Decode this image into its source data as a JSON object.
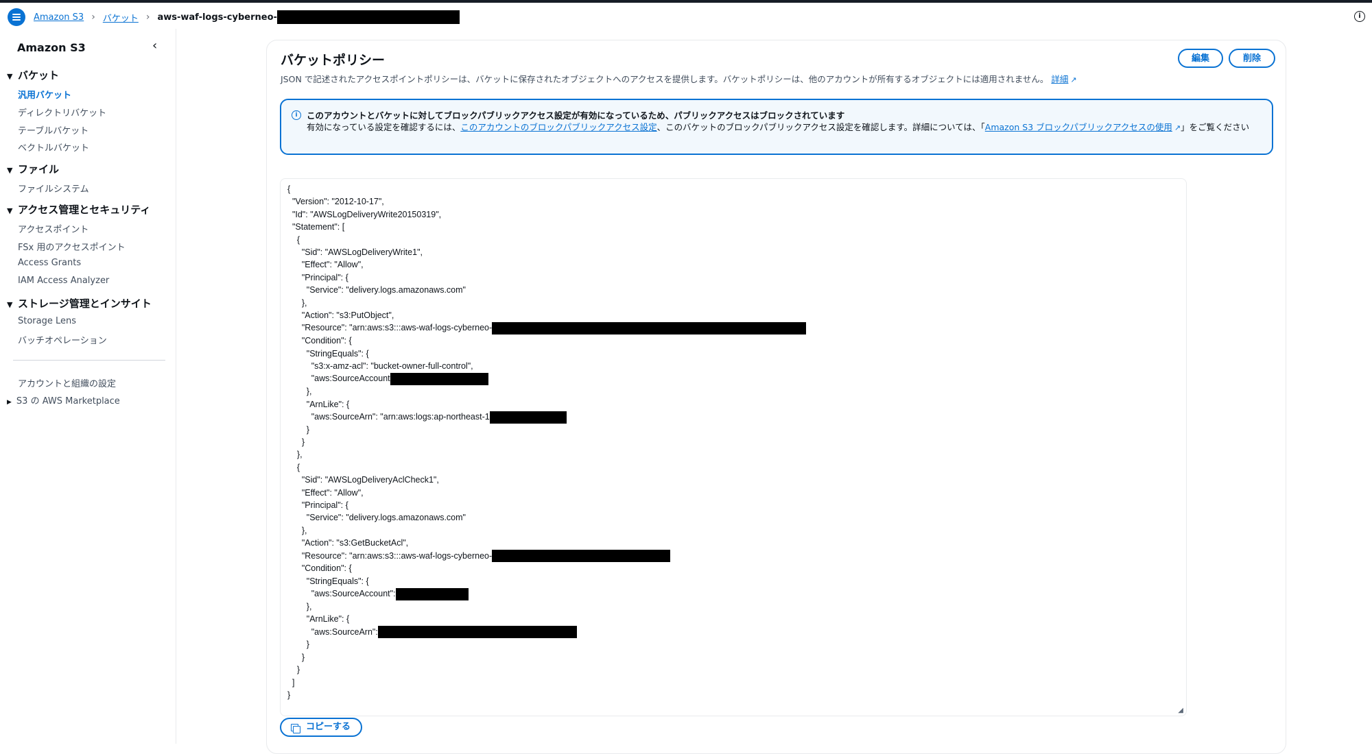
{
  "breadcrumb": {
    "items": [
      "Amazon S3",
      "バケット"
    ],
    "current": "aws-waf-logs-cyberneo-"
  },
  "sidebar": {
    "title": "Amazon S3",
    "sections": [
      {
        "label": "バケット",
        "items": [
          "汎用バケット",
          "ディレクトリバケット",
          "テーブルバケット",
          "ベクトルバケット"
        ]
      },
      {
        "label": "ファイル",
        "items": [
          "ファイルシステム"
        ]
      },
      {
        "label": "アクセス管理とセキュリティ",
        "items": [
          "アクセスポイント",
          "FSx 用のアクセスポイント",
          "Access Grants",
          "IAM Access Analyzer"
        ]
      },
      {
        "label": "ストレージ管理とインサイト",
        "items": [
          "Storage Lens",
          "バッチオペレーション"
        ]
      }
    ],
    "footer_items": [
      "アカウントと組織の設定",
      "S3 の AWS Marketplace"
    ]
  },
  "panel": {
    "title": "バケットポリシー",
    "description": "JSON で記述されたアクセスポイントポリシーは、バケットに保存されたオブジェクトへのアクセスを提供します。バケットポリシーは、他のアカウントが所有するオブジェクトには適用されません。",
    "details_link": "詳細",
    "edit_label": "編集",
    "delete_label": "削除",
    "copy_label": "コピーする"
  },
  "alert": {
    "title": "このアカウントとバケットに対してブロックパブリックアクセス設定が有効になっているため、パブリックアクセスはブロックされています",
    "body_pre": "有効になっている設定を確認するには、",
    "link1": "このアカウントのブロックパブリックアクセス設定",
    "body_mid": "、このバケットのブロックパブリックアクセス設定を確認します。詳細については、「",
    "link2": "Amazon S3 ブロックパブリックアクセスの使用",
    "body_post": "」をご覧ください"
  },
  "policy": {
    "l01": "{",
    "l02": "  \"Version\": \"2012-10-17\",",
    "l03": "  \"Id\": \"AWSLogDeliveryWrite20150319\",",
    "l04": "  \"Statement\": [",
    "l05": "    {",
    "l06": "      \"Sid\": \"AWSLogDeliveryWrite1\",",
    "l07": "      \"Effect\": \"Allow\",",
    "l08": "      \"Principal\": {",
    "l09": "        \"Service\": \"delivery.logs.amazonaws.com\"",
    "l10": "      },",
    "l11": "      \"Action\": \"s3:PutObject\",",
    "l12": "      \"Resource\": \"arn:aws:s3:::aws-waf-logs-cyberneo-",
    "l13": "      \"Condition\": {",
    "l14": "        \"StringEquals\": {",
    "l15": "          \"s3:x-amz-acl\": \"bucket-owner-full-control\",",
    "l16": "          \"aws:SourceAccount",
    "l17": "        },",
    "l18": "        \"ArnLike\": {",
    "l19": "          \"aws:SourceArn\": \"arn:aws:logs:ap-northeast-1",
    "l20": "        }",
    "l21": "      }",
    "l22": "    },",
    "l23": "    {",
    "l24": "      \"Sid\": \"AWSLogDeliveryAclCheck1\",",
    "l25": "      \"Effect\": \"Allow\",",
    "l26": "      \"Principal\": {",
    "l27": "        \"Service\": \"delivery.logs.amazonaws.com\"",
    "l28": "      },",
    "l29": "      \"Action\": \"s3:GetBucketAcl\",",
    "l30": "      \"Resource\": \"arn:aws:s3:::aws-waf-logs-cyberneo-",
    "l31": "      \"Condition\": {",
    "l32": "        \"StringEquals\": {",
    "l33": "          \"aws:SourceAccount\":",
    "l34": "        },",
    "l35": "        \"ArnLike\": {",
    "l36": "          \"aws:SourceArn\":",
    "l37": "        }",
    "l38": "      }",
    "l39": "    }",
    "l40": "  ]",
    "l41": "}"
  }
}
